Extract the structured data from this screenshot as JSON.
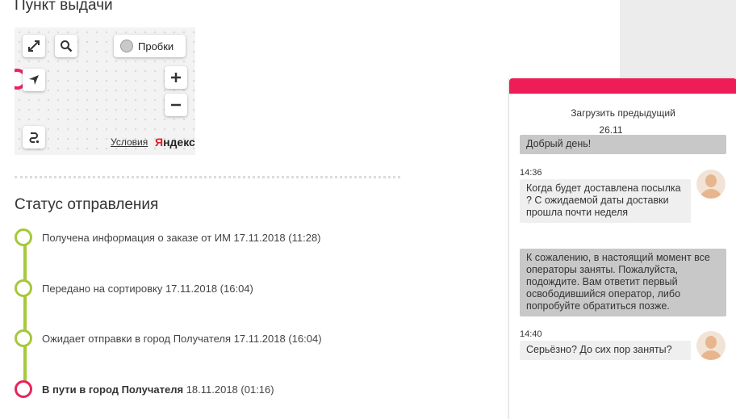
{
  "pickup": {
    "title": "Пункт выдачи",
    "map": {
      "traffic_label": "Пробки",
      "terms_link": "Условия",
      "brand_first": "Я",
      "brand_rest": "ндекс",
      "icons": [
        "expand-icon",
        "search-icon",
        "locate-icon",
        "zoom-in-icon",
        "zoom-out-icon",
        "route-icon"
      ]
    }
  },
  "status": {
    "title": "Статус отправления",
    "items": [
      {
        "text": "Получена информация о заказе от ИМ 17.11.2018 (11:28)",
        "bold": "",
        "current": false
      },
      {
        "text": "Передано на сортировку 17.11.2018 (16:04)",
        "bold": "",
        "current": false
      },
      {
        "text": "Ожидает отправки в город Получателя 17.11.2018 (16:04)",
        "bold": "",
        "current": false
      },
      {
        "text": " 18.11.2018 (01:16)",
        "bold": "В пути в город Получателя",
        "current": true
      }
    ]
  },
  "chat": {
    "load_previous": "Загрузить предыдущий",
    "date": "26.11",
    "messages": [
      {
        "from": "operator",
        "time": "",
        "text": "Добрый день!"
      },
      {
        "from": "user",
        "time": "14:36",
        "text": "Когда будет доставлена посылка                        ? С ожидаемой даты доставки прошла почти неделя"
      },
      {
        "from": "operator",
        "time": "",
        "text": "К сожалению, в настоящий момент все операторы заняты. Пожалуйста, подождите. Вам ответит первый освободившийся оператор, либо попробуйте обратиться позже."
      },
      {
        "from": "user",
        "time": "14:40",
        "text": "Серьёзно? До сих пор заняты?"
      }
    ]
  },
  "colors": {
    "accent": "#ee1c57",
    "timeline_done": "#a5c93a",
    "timeline_current": "#e8245e",
    "operator_bubble": "#c8c8c8",
    "user_bubble": "#efefef"
  }
}
